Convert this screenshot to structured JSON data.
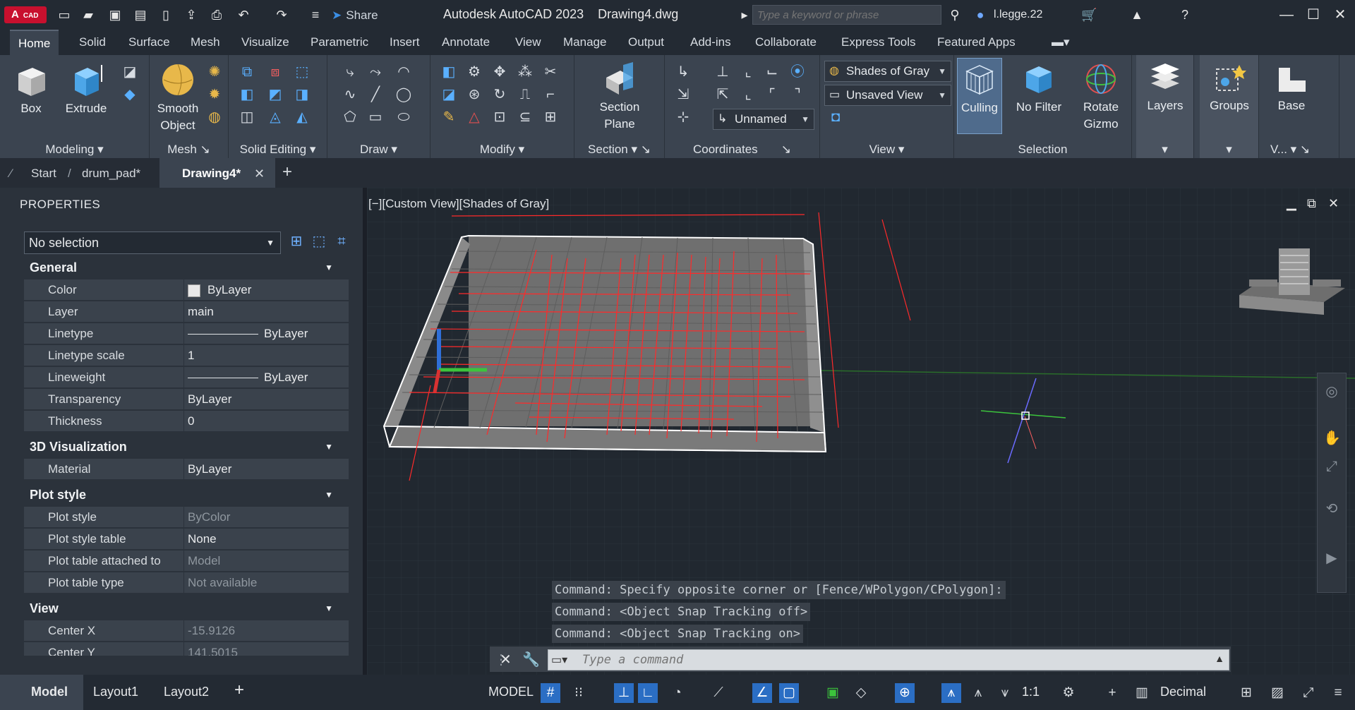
{
  "titlebar": {
    "logo_text": "A",
    "logo_badge": "CAD",
    "share_label": "Share",
    "app_title": "Autodesk AutoCAD 2023",
    "document_name": "Drawing4.dwg",
    "search_placeholder": "Type a keyword or phrase",
    "user_name": "l.legge.22"
  },
  "ribbon_tabs": [
    "Home",
    "Solid",
    "Surface",
    "Mesh",
    "Visualize",
    "Parametric",
    "Insert",
    "Annotate",
    "View",
    "Manage",
    "Output",
    "Add-ins",
    "Collaborate",
    "Express Tools",
    "Featured Apps"
  ],
  "ribbon": {
    "modeling": {
      "title": "Modeling",
      "box": "Box",
      "extrude": "Extrude"
    },
    "mesh": {
      "title": "Mesh",
      "smooth_object": "Smooth Object"
    },
    "solid_editing": {
      "title": "Solid Editing"
    },
    "draw": {
      "title": "Draw"
    },
    "modify": {
      "title": "Modify"
    },
    "section": {
      "title": "Section",
      "section_plane": "Section Plane"
    },
    "coordinates": {
      "title": "Coordinates",
      "ucs_name": "Unnamed"
    },
    "view": {
      "title": "View",
      "visual_style": "Shades of Gray",
      "named_view": "Unsaved View"
    },
    "selection": {
      "title": "Selection",
      "culling": "Culling",
      "no_filter": "No Filter",
      "rotate_gizmo": "Rotate Gizmo"
    },
    "layers": {
      "label": "Layers"
    },
    "groups": {
      "label": "Groups"
    },
    "base": {
      "label": "Base",
      "title": "V..."
    }
  },
  "doc_tabs": [
    "Start",
    "drum_pad*",
    "Drawing4*"
  ],
  "properties": {
    "title": "PROPERTIES",
    "selection": "No selection",
    "sections": [
      {
        "name": "General",
        "rows": [
          {
            "key": "Color",
            "value": "ByLayer"
          },
          {
            "key": "Layer",
            "value": "main"
          },
          {
            "key": "Linetype",
            "value": "ByLayer"
          },
          {
            "key": "Linetype scale",
            "value": "1"
          },
          {
            "key": "Lineweight",
            "value": "ByLayer"
          },
          {
            "key": "Transparency",
            "value": "ByLayer"
          },
          {
            "key": "Thickness",
            "value": "0"
          }
        ]
      },
      {
        "name": "3D Visualization",
        "rows": [
          {
            "key": "Material",
            "value": "ByLayer"
          }
        ]
      },
      {
        "name": "Plot style",
        "rows": [
          {
            "key": "Plot style",
            "value": "ByColor"
          },
          {
            "key": "Plot style table",
            "value": "None"
          },
          {
            "key": "Plot table attached to",
            "value": "Model"
          },
          {
            "key": "Plot table type",
            "value": "Not available"
          }
        ]
      },
      {
        "name": "View",
        "rows": [
          {
            "key": "Center X",
            "value": "-15.9126"
          },
          {
            "key": "Center Y",
            "value": "141.5015"
          }
        ]
      }
    ]
  },
  "viewport": {
    "label": "[−][Custom View][Shades of Gray]"
  },
  "command_history": [
    "Command: Specify opposite corner or [Fence/WPolygon/CPolygon]:",
    "Command:  <Object Snap Tracking off>",
    "Command:  <Object Snap Tracking on>"
  ],
  "command_placeholder": "Type a command",
  "status": {
    "layout_tabs": [
      "Model",
      "Layout1",
      "Layout2"
    ],
    "model_label": "MODEL",
    "scale": "1:1",
    "units": "Decimal"
  }
}
